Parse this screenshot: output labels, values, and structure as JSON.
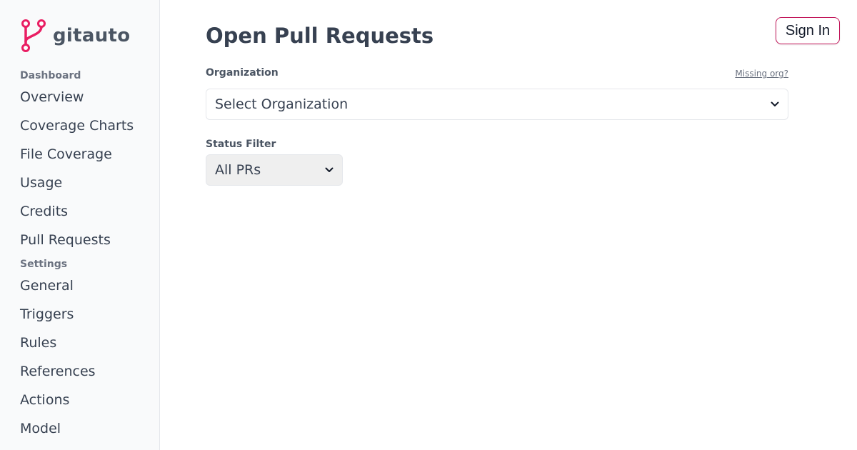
{
  "brand": {
    "name": "gitauto",
    "accent": "#e91e63",
    "logo_icon": "git-branch-icon"
  },
  "sidebar": {
    "sections": [
      {
        "label": "Dashboard",
        "items": [
          {
            "label": "Overview"
          },
          {
            "label": "Coverage Charts"
          },
          {
            "label": "File Coverage"
          },
          {
            "label": "Usage"
          },
          {
            "label": "Credits"
          },
          {
            "label": "Pull Requests"
          }
        ]
      },
      {
        "label": "Settings",
        "items": [
          {
            "label": "General"
          },
          {
            "label": "Triggers"
          },
          {
            "label": "Rules"
          },
          {
            "label": "References"
          },
          {
            "label": "Actions"
          },
          {
            "label": "Model"
          }
        ]
      }
    ]
  },
  "main": {
    "title": "Open Pull Requests",
    "organization": {
      "label": "Organization",
      "missing_link": "Missing org?",
      "selected": "Select Organization"
    },
    "status_filter": {
      "label": "Status Filter",
      "selected": "All PRs"
    }
  },
  "header": {
    "sign_in_label": "Sign In",
    "sign_in_border_color": "#c2185b"
  }
}
